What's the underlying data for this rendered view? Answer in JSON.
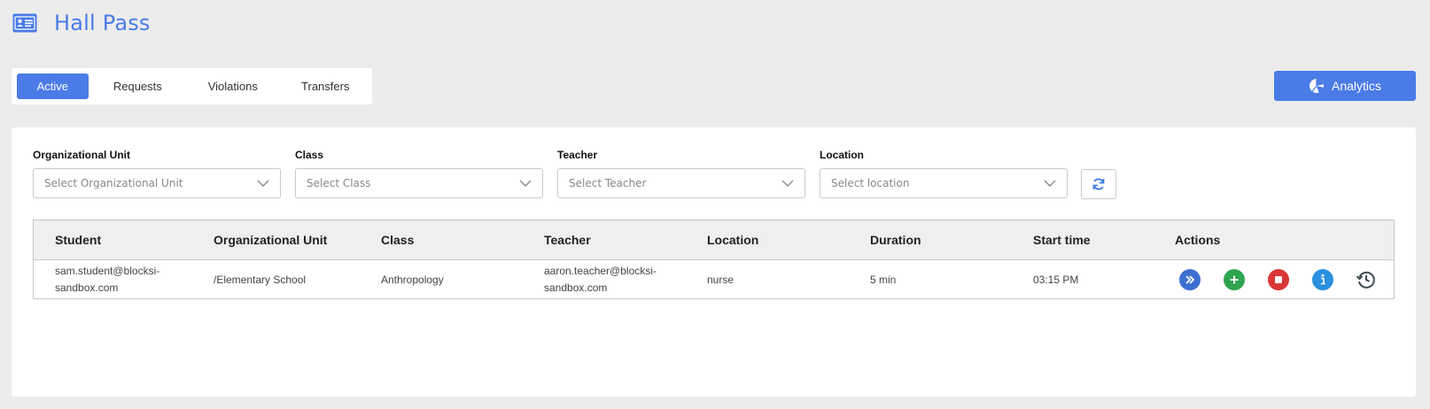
{
  "app": {
    "title": "Hall Pass",
    "icon": "id-card-icon"
  },
  "tabs": [
    {
      "label": "Active",
      "active": true
    },
    {
      "label": "Requests",
      "active": false
    },
    {
      "label": "Violations",
      "active": false
    },
    {
      "label": "Transfers",
      "active": false
    }
  ],
  "analytics": {
    "label": "Analytics",
    "icon": "pie-chart-icon"
  },
  "filters": [
    {
      "label": "Organizational Unit",
      "placeholder": "Select Organizational Unit"
    },
    {
      "label": "Class",
      "placeholder": "Select Class"
    },
    {
      "label": "Teacher",
      "placeholder": "Select Teacher"
    },
    {
      "label": "Location",
      "placeholder": "Select location"
    }
  ],
  "refresh": {
    "icon": "refresh-icon"
  },
  "table": {
    "columns": [
      "Student",
      "Organizational Unit",
      "Class",
      "Teacher",
      "Location",
      "Duration",
      "Start time",
      "Actions"
    ],
    "rows": [
      {
        "student_line1": "sam.student@blocksi-",
        "student_line2": "sandbox.com",
        "org_unit": "/Elementary School",
        "class": "Anthropology",
        "teacher_line1": "aaron.teacher@blocksi-",
        "teacher_line2": "sandbox.com",
        "location": "nurse",
        "duration": "5 min",
        "start_time": "03:15 PM"
      }
    ],
    "actions": [
      {
        "icon": "transfer-icon",
        "color": "#3d6fd0"
      },
      {
        "icon": "extend-icon",
        "color": "#2ea44f"
      },
      {
        "icon": "stop-icon",
        "color": "#d93636"
      },
      {
        "icon": "info-icon",
        "color": "#2b8fe0"
      },
      {
        "icon": "history-icon",
        "color": "#3d4a52"
      }
    ]
  },
  "colors": {
    "accent": "#4a7be6",
    "background": "#ececec"
  }
}
